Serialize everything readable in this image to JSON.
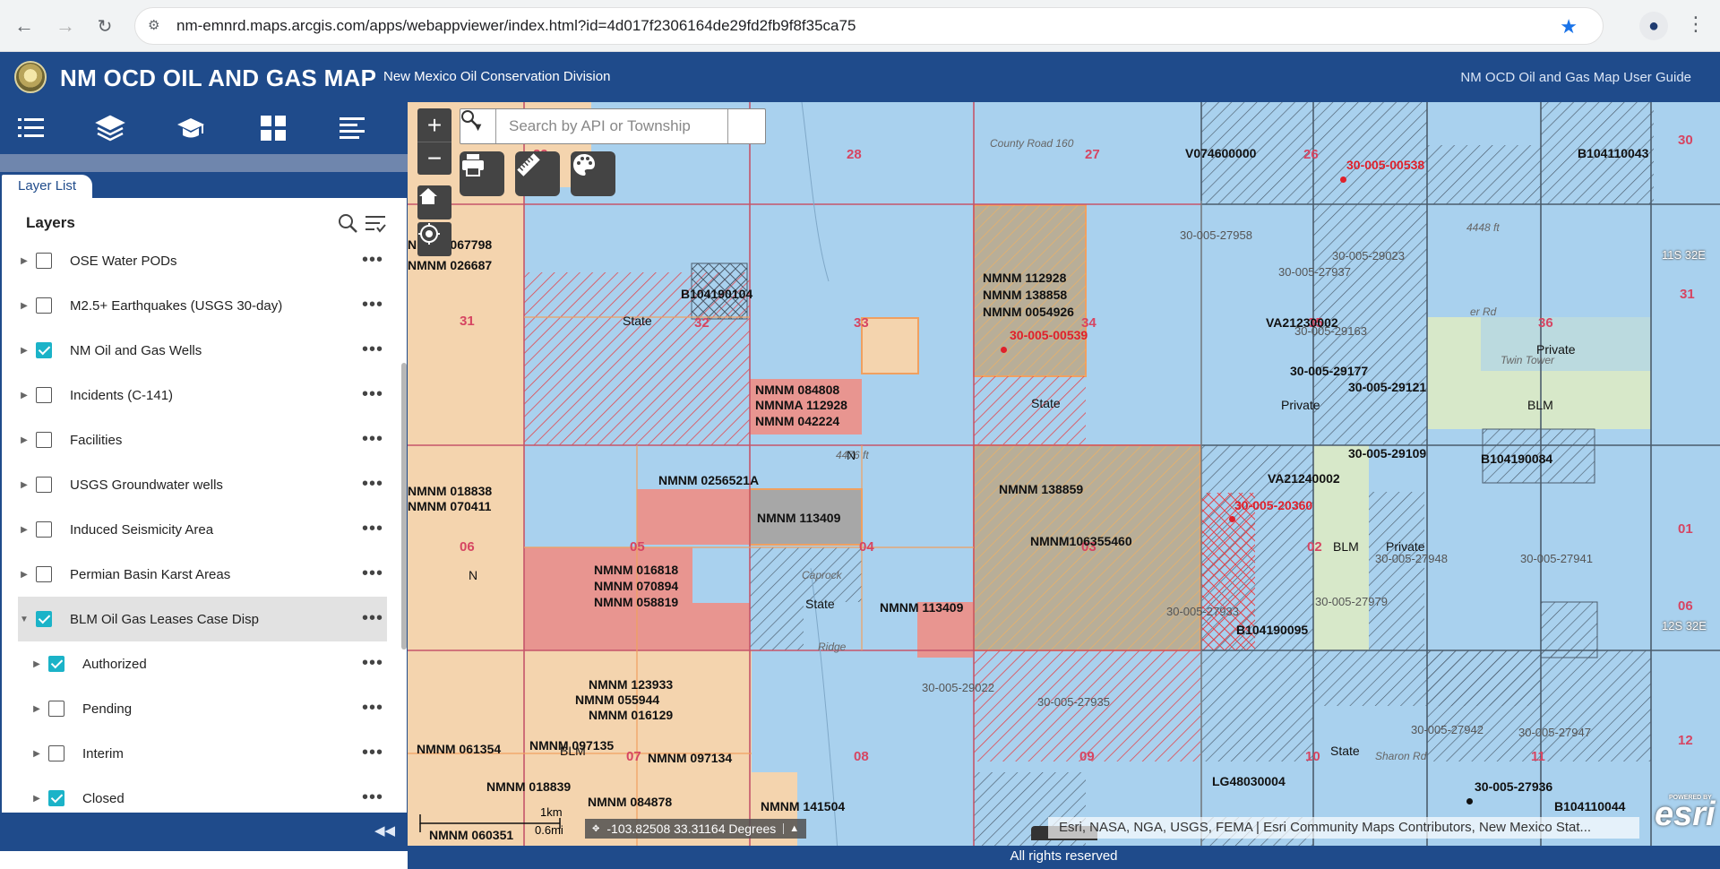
{
  "browser": {
    "url": "nm-emnrd.maps.arcgis.com/apps/webappviewer/index.html?id=4d017f2306164de29fd2fb9f8f35ca75"
  },
  "header": {
    "title": "NM OCD OIL AND GAS MAP",
    "subtitle": "New Mexico Oil Conservation Division",
    "guide_link": "NM OCD Oil and Gas Map User Guide"
  },
  "panel": {
    "tab_label": "Layer List",
    "title": "Layers",
    "layers": [
      {
        "label": "OSE Water PODs",
        "checked": false,
        "expanded": false,
        "indent": 0
      },
      {
        "label": "M2.5+ Earthquakes (USGS 30-day)",
        "checked": false,
        "expanded": false,
        "indent": 0
      },
      {
        "label": "NM Oil and Gas Wells",
        "checked": true,
        "expanded": false,
        "indent": 0
      },
      {
        "label": "Incidents (C-141)",
        "checked": false,
        "expanded": false,
        "indent": 0
      },
      {
        "label": "Facilities",
        "checked": false,
        "expanded": false,
        "indent": 0
      },
      {
        "label": "USGS Groundwater wells",
        "checked": false,
        "expanded": false,
        "indent": 0
      },
      {
        "label": "Induced Seismicity Area",
        "checked": false,
        "expanded": false,
        "indent": 0
      },
      {
        "label": "Permian Basin Karst Areas",
        "checked": false,
        "expanded": false,
        "indent": 0
      },
      {
        "label": "BLM Oil Gas Leases Case Disp",
        "checked": true,
        "expanded": true,
        "indent": 0
      },
      {
        "label": "Authorized",
        "checked": true,
        "expanded": false,
        "indent": 1
      },
      {
        "label": "Pending",
        "checked": false,
        "expanded": false,
        "indent": 1
      },
      {
        "label": "Interim",
        "checked": false,
        "expanded": false,
        "indent": 1
      },
      {
        "label": "Closed",
        "checked": true,
        "expanded": false,
        "indent": 1
      }
    ]
  },
  "map": {
    "search_placeholder": "Search by API or Township",
    "coordinates": "-103.82508 33.31164 Degrees",
    "scale_km": "1km",
    "scale_mi": "0.6mi",
    "attribution": "Esri, NASA, NGA, USGS, FEMA | Esri Community Maps Contributors, New Mexico Stat...",
    "esri_logo": "esri",
    "powered_by": "POWERED BY",
    "sections": [
      "29",
      "28",
      "27",
      "26",
      "30",
      "31",
      "32",
      "33",
      "34",
      "35",
      "36",
      "31",
      "06",
      "05",
      "04",
      "03",
      "02",
      "01",
      "06",
      "07",
      "08",
      "09",
      "10",
      "11",
      "12",
      "07"
    ],
    "township_labels": [
      "11S 32E",
      "12S 32E"
    ],
    "road_labels": [
      "County Road 160",
      "Caprock",
      "Ridge",
      "4476 ft",
      "4448 ft",
      "Sharon Rd",
      "Twin Tower",
      "er Rd"
    ],
    "ownership": [
      "State",
      "Private",
      "BLM"
    ],
    "lease_labels": [
      "NMNM 067798",
      "NMNM 026687",
      "B104190104",
      "NMNM 112928",
      "NMNM 138858",
      "NMNM 0054926",
      "V074600000",
      "B104110043",
      "NMNM 084808",
      "NMNMA 112928",
      "NMNM 042224",
      "NMNM 018838",
      "NMNM 070411",
      "NMNM 0256521A",
      "NMNM 113409",
      "NMNM 138859",
      "NMNM106355460",
      "VA21230002",
      "VA21240002",
      "B104190084",
      "NMNM 016818",
      "NMNM 070894",
      "NMNM 058819",
      "NMNM 113409",
      "B104190095",
      "NMNM 123933",
      "NMNM 055944",
      "NMNM 016129",
      "NMNM 097135",
      "NMNM 097134",
      "NMNM 061354",
      "NMNM 018839",
      "NMNM 084878",
      "NMNM 141504",
      "NMNM 060351",
      "LG48030004",
      "B104110044"
    ],
    "well_labels_red": [
      "30-005-00538",
      "30-005-00539",
      "30-005-20360"
    ],
    "well_labels_black": [
      "30-005-29177",
      "30-005-29121",
      "30-005-29109",
      "30-005-27936"
    ],
    "well_labels_gray": [
      "30-005-27958",
      "30-005-29023",
      "30-005-27937",
      "30-005-29163",
      "30-005-27948",
      "30-005-27941",
      "30-005-27979",
      "30-005-27933",
      "30-005-29022",
      "30-005-27935",
      "30-005-27942",
      "30-005-27947"
    ]
  },
  "footer": {
    "text": "All rights reserved"
  }
}
